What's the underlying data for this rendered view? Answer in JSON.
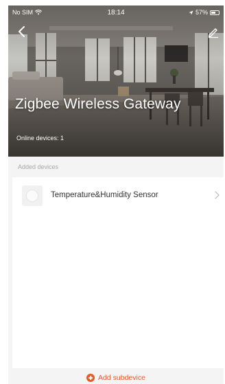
{
  "status_bar": {
    "carrier": "No SIM",
    "time": "18:14",
    "battery": "57%",
    "battery_level": 0.57,
    "icons": [
      "wifi-icon",
      "location-arrow-icon",
      "battery-icon"
    ]
  },
  "header": {
    "title": "Zigbee Wireless Gateway",
    "online_devices": "Online devices: 1",
    "back_icon": "chevron-left-icon",
    "edit_icon": "pencil-icon"
  },
  "devices_section": {
    "label": "Added devices",
    "items": [
      {
        "name": "Temperature&Humidity Sensor",
        "icon": "sensor-icon",
        "trailing_icon": "chevron-right-icon"
      }
    ]
  },
  "footer": {
    "add_label": "Add subdevice",
    "icon": "plus-circle-icon",
    "accent_color": "#e75a2a"
  }
}
